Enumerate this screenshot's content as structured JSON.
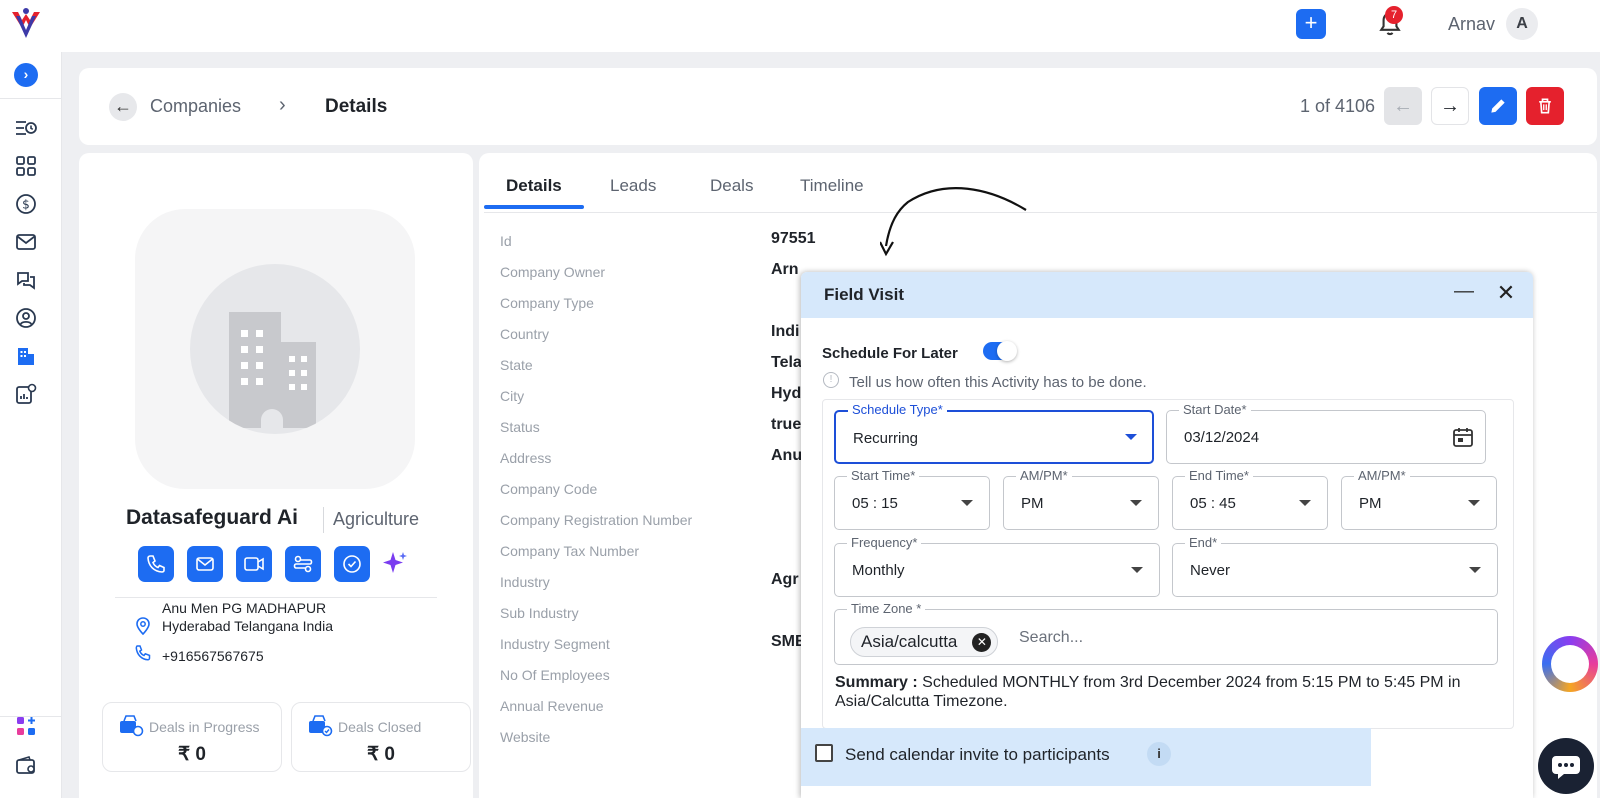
{
  "topbar": {
    "notification_count": "7",
    "user_name": "Arnav",
    "user_initial": "A"
  },
  "header": {
    "breadcrumb_parent": "Companies",
    "breadcrumb_sep": "›",
    "breadcrumb_current": "Details",
    "pager": "1 of 4106"
  },
  "profile": {
    "company_name": "Datasafeguard Ai",
    "industry": "Agriculture",
    "address_line1": "Anu Men PG MADHAPUR",
    "address_line2": "Hyderabad Telangana India",
    "phone": "+916567567675",
    "stats": [
      {
        "label": "Deals in Progress",
        "value": "₹ 0"
      },
      {
        "label": "Deals Closed",
        "value": "₹ 0"
      }
    ]
  },
  "tabs": [
    "Details",
    "Leads",
    "Deals",
    "Timeline"
  ],
  "fields": [
    {
      "label": "Id",
      "value": "97551"
    },
    {
      "label": "Company Owner",
      "value": "Arn"
    },
    {
      "label": "Company Type",
      "value": ""
    },
    {
      "label": "Country",
      "value": "Indi"
    },
    {
      "label": "State",
      "value": "Tela"
    },
    {
      "label": "City",
      "value": "Hyd"
    },
    {
      "label": "Status",
      "value": "true"
    },
    {
      "label": "Address",
      "value": "Anu"
    },
    {
      "label": "Company Code",
      "value": ""
    },
    {
      "label": "Company Registration Number",
      "value": ""
    },
    {
      "label": "Company Tax Number",
      "value": ""
    },
    {
      "label": "Industry",
      "value": "Agr"
    },
    {
      "label": "Sub Industry",
      "value": ""
    },
    {
      "label": "Industry Segment",
      "value": "SME"
    },
    {
      "label": "No Of Employees",
      "value": ""
    },
    {
      "label": "Annual Revenue",
      "value": ""
    },
    {
      "label": "Website",
      "value": ""
    }
  ],
  "dialog": {
    "title": "Field Visit",
    "schedule_for_later_label": "Schedule For Later",
    "schedule_for_later_on": true,
    "hint": "Tell us how often this Activity has to be done.",
    "schedule_type": {
      "label": "Schedule Type*",
      "value": "Recurring"
    },
    "start_date": {
      "label": "Start Date*",
      "value": "03/12/2024"
    },
    "start_time": {
      "label": "Start Time*",
      "value": "05 : 15"
    },
    "start_ampm": {
      "label": "AM/PM*",
      "value": "PM"
    },
    "end_time": {
      "label": "End Time*",
      "value": "05 : 45"
    },
    "end_ampm": {
      "label": "AM/PM*",
      "value": "PM"
    },
    "frequency": {
      "label": "Frequency*",
      "value": "Monthly"
    },
    "end": {
      "label": "End*",
      "value": "Never"
    },
    "timezone": {
      "label": "Time Zone *",
      "chip": "Asia/calcutta",
      "placeholder": "Search..."
    },
    "summary_label": "Summary :",
    "summary_text": " Scheduled MONTHLY from 3rd December 2024 from 5:15 PM to 5:45 PM in Asia/Calcutta Timezone.",
    "invite_label": "Send calendar invite to participants",
    "invite_checked": false
  },
  "colors": {
    "primary": "#1d6cf2",
    "danger": "#e5212d",
    "dialog_header": "#d6e8fb"
  }
}
